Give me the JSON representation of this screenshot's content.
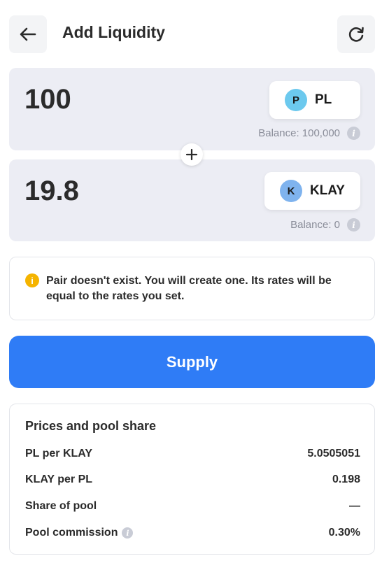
{
  "header": {
    "title": "Add Liquidity",
    "back_icon": "arrow-left-icon",
    "refresh_icon": "refresh-icon"
  },
  "input_a": {
    "amount": "100",
    "token_symbol": "PL",
    "token_logo_letter": "P",
    "token_logo_color": "#6cc9ee",
    "balance": "Balance: 100,000"
  },
  "input_b": {
    "amount": "19.8",
    "token_symbol": "KLAY",
    "token_logo_letter": "K",
    "token_logo_color": "#7fb3ee",
    "balance": "Balance: 0"
  },
  "notice": {
    "icon": "info-warning-icon",
    "icon_char": "i",
    "text": "Pair doesn't exist. You will create one. Its rates will be equal to the rates you set."
  },
  "supply": {
    "label": "Supply",
    "color": "#2f7cf6"
  },
  "pool": {
    "title": "Prices and pool share",
    "rows": [
      {
        "label": "PL per KLAY",
        "value": "5.0505051"
      },
      {
        "label": "KLAY per PL",
        "value": "0.198"
      },
      {
        "label": "Share of pool",
        "value": "—"
      },
      {
        "label": "Pool commission",
        "value": "0.30%"
      }
    ]
  },
  "info_char": "i"
}
